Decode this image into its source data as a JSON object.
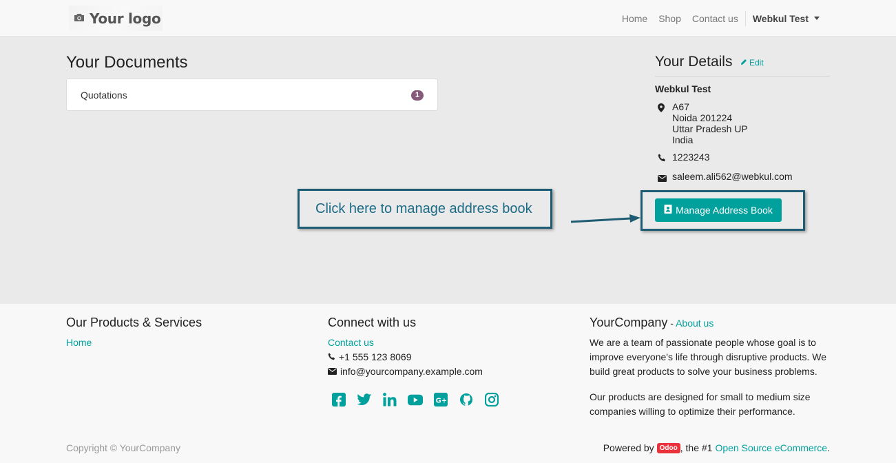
{
  "navbar": {
    "logo_text": "Your logo",
    "links": [
      "Home",
      "Shop",
      "Contact us"
    ],
    "user": "Webkul Test"
  },
  "documents": {
    "title": "Your Documents",
    "items": [
      {
        "label": "Quotations",
        "count": "1"
      }
    ]
  },
  "details": {
    "title": "Your Details",
    "edit": "Edit",
    "name": "Webkul Test",
    "address": [
      "A67",
      "Noida 201224",
      "Uttar Pradesh UP",
      "India"
    ],
    "phone": "1223243",
    "email": "saleem.ali562@webkul.com",
    "manage_button": "Manage Address Book"
  },
  "annotation": {
    "callout": "Click here to manage address book"
  },
  "footer": {
    "products_title": "Our Products & Services",
    "products_link": "Home",
    "connect_title": "Connect with us",
    "contact_link": "Contact us",
    "phone": "+1 555 123 8069",
    "email": "info@yourcompany.example.com",
    "socials": [
      "facebook-icon",
      "twitter-icon",
      "linkedin-icon",
      "youtube-icon",
      "google-plus-icon",
      "github-icon",
      "instagram-icon"
    ],
    "company_title": "YourCompany",
    "company_sep": " - ",
    "about_link": "About us",
    "about_text_1": "We are a team of passionate people whose goal is to improve everyone's life through disruptive products. We build great products to solve your business problems.",
    "about_text_2": "Our products are designed for small to medium size companies willing to optimize their performance.",
    "copyright": "Copyright © YourCompany",
    "powered_prefix": "Powered by",
    "powered_badge": "Odoo",
    "powered_mid": ", the #1",
    "powered_link": "Open Source eCommerce",
    "powered_end": "."
  },
  "colors": {
    "accent": "#00a09d",
    "badge": "#875a7b",
    "annotation": "#1d5c72",
    "odoo": "#e9323c"
  }
}
